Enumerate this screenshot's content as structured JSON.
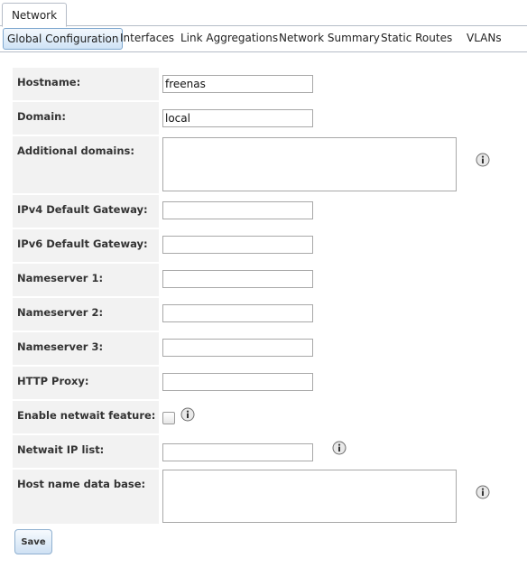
{
  "top_tab": {
    "label": "Network"
  },
  "subtabs": [
    {
      "label": "Global Configuration",
      "active": true
    },
    {
      "label": "Interfaces"
    },
    {
      "label": "Link Aggregations"
    },
    {
      "label": "Network Summary"
    },
    {
      "label": "Static Routes"
    },
    {
      "label": "VLANs"
    }
  ],
  "form": {
    "hostname": {
      "label": "Hostname:",
      "value": "freenas"
    },
    "domain": {
      "label": "Domain:",
      "value": "local"
    },
    "additional_domains": {
      "label": "Additional domains:",
      "value": ""
    },
    "ipv4_gateway": {
      "label": "IPv4 Default Gateway:",
      "value": ""
    },
    "ipv6_gateway": {
      "label": "IPv6 Default Gateway:",
      "value": ""
    },
    "nameserver1": {
      "label": "Nameserver 1:",
      "value": ""
    },
    "nameserver2": {
      "label": "Nameserver 2:",
      "value": ""
    },
    "nameserver3": {
      "label": "Nameserver 3:",
      "value": ""
    },
    "http_proxy": {
      "label": "HTTP Proxy:",
      "value": ""
    },
    "netwait": {
      "label": "Enable netwait feature:",
      "checked": false
    },
    "netwait_ip_list": {
      "label": "Netwait IP list:",
      "value": ""
    },
    "host_db": {
      "label": "Host name data base:",
      "value": ""
    }
  },
  "save_label": "Save",
  "icons": {
    "info": "info-icon"
  }
}
